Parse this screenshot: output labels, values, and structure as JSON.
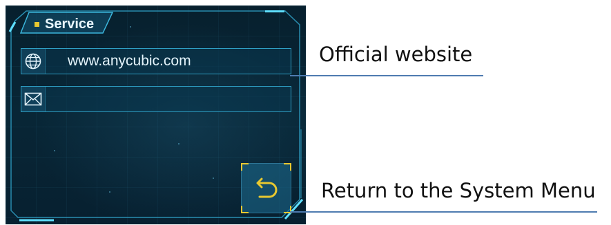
{
  "screen": {
    "title": "Service",
    "rows": [
      {
        "icon": "globe-icon",
        "text": "www.anycubic.com"
      },
      {
        "icon": "envelope-icon",
        "text": ""
      }
    ],
    "return_button": {
      "icon": "return-arrow-icon"
    }
  },
  "annotations": {
    "official_website": "Official website",
    "return_menu": "Return to the System Menu"
  },
  "colors": {
    "screen_bg": "#082636",
    "frame_cyan": "#2f9fc4",
    "accent_yellow": "#e8c830",
    "leader_line": "#4e7bb0"
  }
}
